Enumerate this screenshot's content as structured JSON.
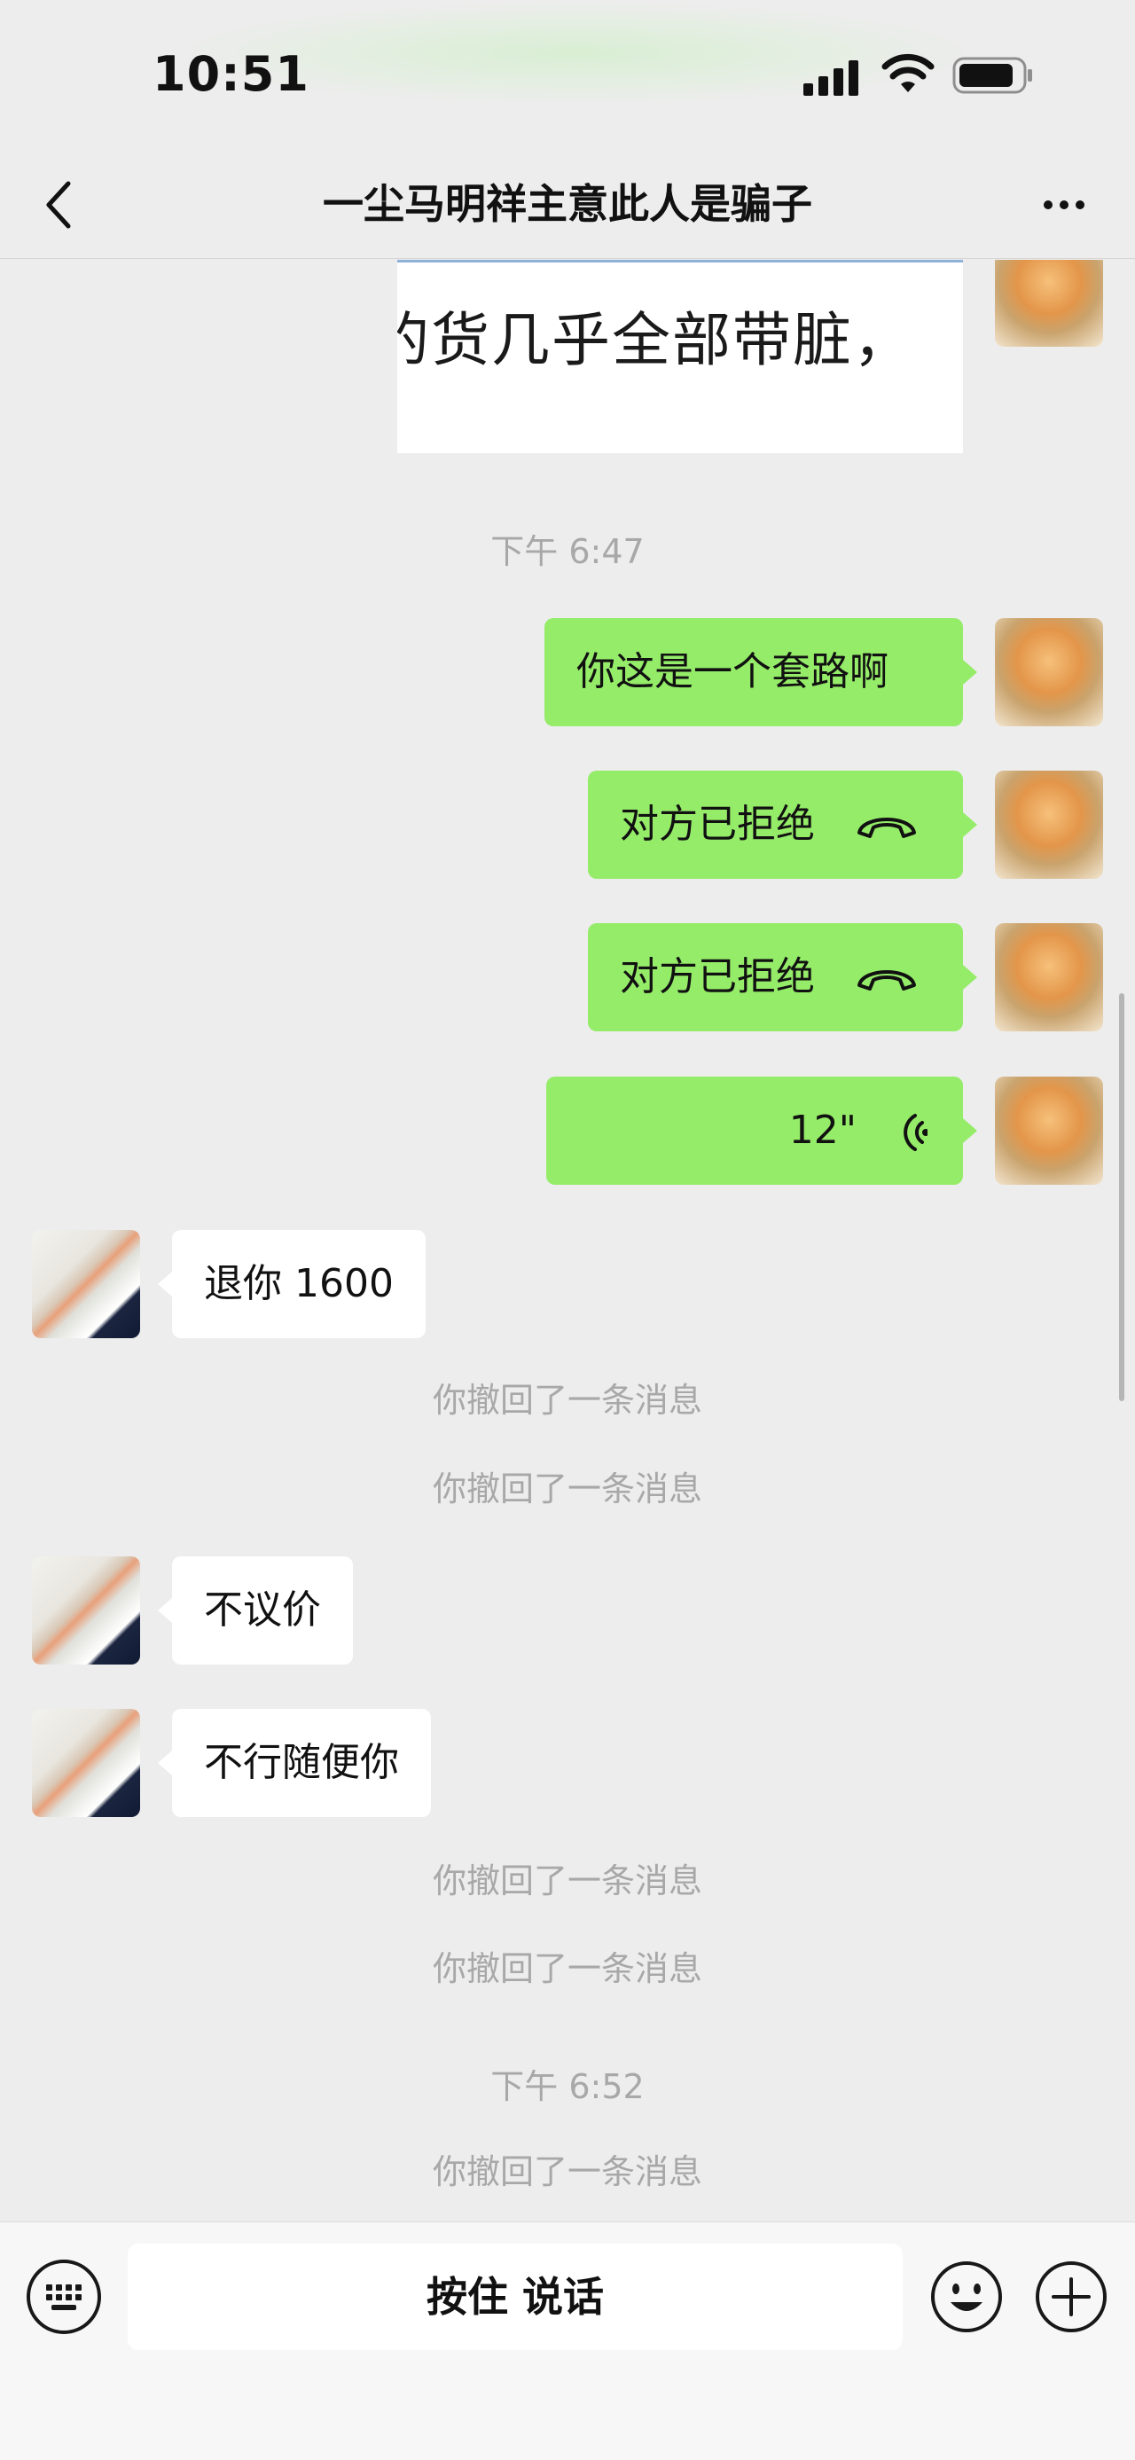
{
  "status_bar": {
    "time": "10:51",
    "signal_icon": "cellular-signal-icon",
    "wifi_icon": "wifi-icon",
    "battery_icon": "battery-icon"
  },
  "nav": {
    "title": "一尘马明祥主意此人是骗子",
    "back_icon": "chevron-left-icon",
    "more_icon": "more-dots-icon"
  },
  "chat": {
    "image_message_text": "的货几乎全部带脏，",
    "timestamp_1": "下午 6:47",
    "msg_taolu": "你这是一个套路啊",
    "call_declined_1": "对方已拒绝",
    "call_declined_2": "对方已拒绝",
    "voice_duration": "12\"",
    "msg_refund": "退你 1600",
    "recall_1": "你撤回了一条消息",
    "recall_2": "你撤回了一条消息",
    "msg_no_bargain": "不议价",
    "msg_whatever": "不行随便你",
    "recall_3": "你撤回了一条消息",
    "recall_4": "你撤回了一条消息",
    "timestamp_2": "下午 6:52",
    "recall_5": "你撤回了一条消息"
  },
  "input_bar": {
    "talk_label": "按住 说话",
    "keyboard_icon": "keyboard-icon",
    "emoji_icon": "emoji-icon",
    "plus_icon": "plus-icon"
  },
  "colors": {
    "bubble_sent": "#95ec69",
    "bubble_received": "#ffffff",
    "background": "#ededed",
    "system_text": "#a8a8a8"
  }
}
